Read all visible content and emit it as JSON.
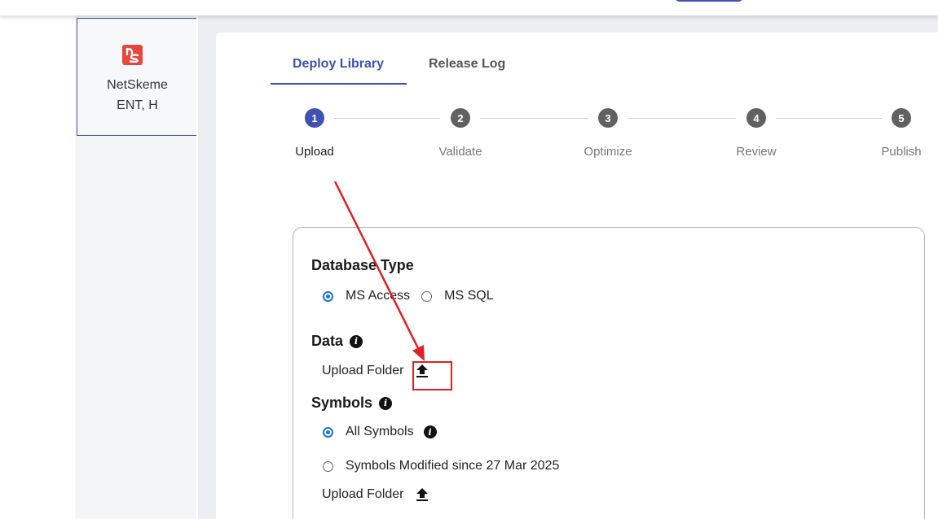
{
  "sidebar": {
    "tenant_name": "NetSkeme",
    "tenant_sub": "ENT, H",
    "logo_text": "ns",
    "logo_color": "#e8453c"
  },
  "tabs": [
    {
      "label": "Deploy Library",
      "active": true
    },
    {
      "label": "Release Log",
      "active": false
    }
  ],
  "stepper": {
    "active_color": "#3f51b5",
    "inactive_color": "#616161",
    "steps": [
      {
        "num": "1",
        "label": "Upload",
        "active": true
      },
      {
        "num": "2",
        "label": "Validate",
        "active": false
      },
      {
        "num": "3",
        "label": "Optimize",
        "active": false
      },
      {
        "num": "4",
        "label": "Review",
        "active": false
      },
      {
        "num": "5",
        "label": "Publish",
        "active": false
      }
    ]
  },
  "form": {
    "database_type": {
      "title": "Database Type",
      "options": [
        {
          "label": "MS Access",
          "checked": true
        },
        {
          "label": "MS SQL",
          "checked": false
        }
      ]
    },
    "data": {
      "title": "Data",
      "info_icon": "info-icon",
      "upload_label": "Upload Folder",
      "upload_icon": "upload-icon"
    },
    "symbols": {
      "title": "Symbols",
      "info_icon": "info-icon",
      "options": [
        {
          "label": "All Symbols",
          "checked": true,
          "info": true
        },
        {
          "label": "Symbols Modified since 27 Mar 2025",
          "checked": false,
          "info": false
        }
      ],
      "upload_label": "Upload Folder",
      "upload_icon": "upload-icon"
    }
  },
  "annotation": {
    "color": "#e02020"
  }
}
